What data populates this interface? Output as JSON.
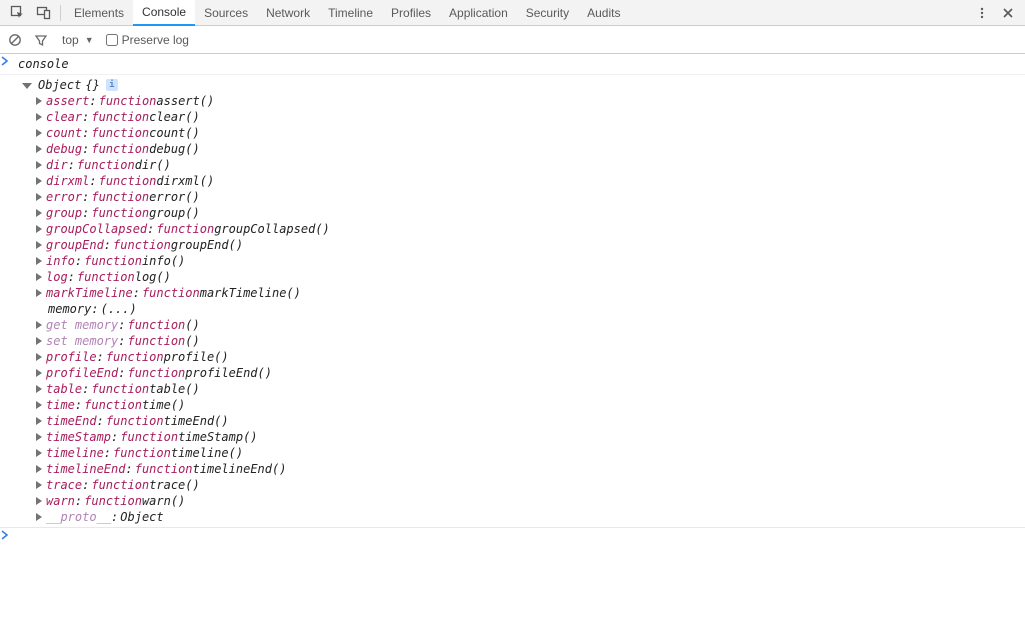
{
  "tabs": {
    "items": [
      "Elements",
      "Console",
      "Sources",
      "Network",
      "Timeline",
      "Profiles",
      "Application",
      "Security",
      "Audits"
    ],
    "active_index": 1
  },
  "toolbar": {
    "context": "top",
    "preserve_log_label": "Preserve log",
    "preserve_log_checked": false
  },
  "console": {
    "input": "console",
    "object_label": "Object",
    "object_braces": "{}",
    "properties": [
      {
        "name": "assert",
        "kind": "fn",
        "fn": "assert()"
      },
      {
        "name": "clear",
        "kind": "fn",
        "fn": "clear()"
      },
      {
        "name": "count",
        "kind": "fn",
        "fn": "count()"
      },
      {
        "name": "debug",
        "kind": "fn",
        "fn": "debug()"
      },
      {
        "name": "dir",
        "kind": "fn",
        "fn": "dir()"
      },
      {
        "name": "dirxml",
        "kind": "fn",
        "fn": "dirxml()"
      },
      {
        "name": "error",
        "kind": "fn",
        "fn": "error()"
      },
      {
        "name": "group",
        "kind": "fn",
        "fn": "group()"
      },
      {
        "name": "groupCollapsed",
        "kind": "fn",
        "fn": "groupCollapsed()"
      },
      {
        "name": "groupEnd",
        "kind": "fn",
        "fn": "groupEnd()"
      },
      {
        "name": "info",
        "kind": "fn",
        "fn": "info()"
      },
      {
        "name": "log",
        "kind": "fn",
        "fn": "log()"
      },
      {
        "name": "markTimeline",
        "kind": "fn",
        "fn": "markTimeline()"
      },
      {
        "name": "memory",
        "kind": "ellipsis",
        "value": "(...)"
      },
      {
        "name": "get memory",
        "kind": "accessor",
        "fn": "()"
      },
      {
        "name": "set memory",
        "kind": "accessor",
        "fn": "()"
      },
      {
        "name": "profile",
        "kind": "fn",
        "fn": "profile()"
      },
      {
        "name": "profileEnd",
        "kind": "fn",
        "fn": "profileEnd()"
      },
      {
        "name": "table",
        "kind": "fn",
        "fn": "table()"
      },
      {
        "name": "time",
        "kind": "fn",
        "fn": "time()"
      },
      {
        "name": "timeEnd",
        "kind": "fn",
        "fn": "timeEnd()"
      },
      {
        "name": "timeStamp",
        "kind": "fn",
        "fn": "timeStamp()"
      },
      {
        "name": "timeline",
        "kind": "fn",
        "fn": "timeline()"
      },
      {
        "name": "timelineEnd",
        "kind": "fn",
        "fn": "timelineEnd()"
      },
      {
        "name": "trace",
        "kind": "fn",
        "fn": "trace()"
      },
      {
        "name": "warn",
        "kind": "fn",
        "fn": "warn()"
      },
      {
        "name": "__proto__",
        "kind": "proto",
        "value": "Object"
      }
    ],
    "function_keyword": "function"
  },
  "colors": {
    "property": "#a71d5d",
    "accessor": "#b183b5",
    "active_tab": "#2196f3"
  }
}
